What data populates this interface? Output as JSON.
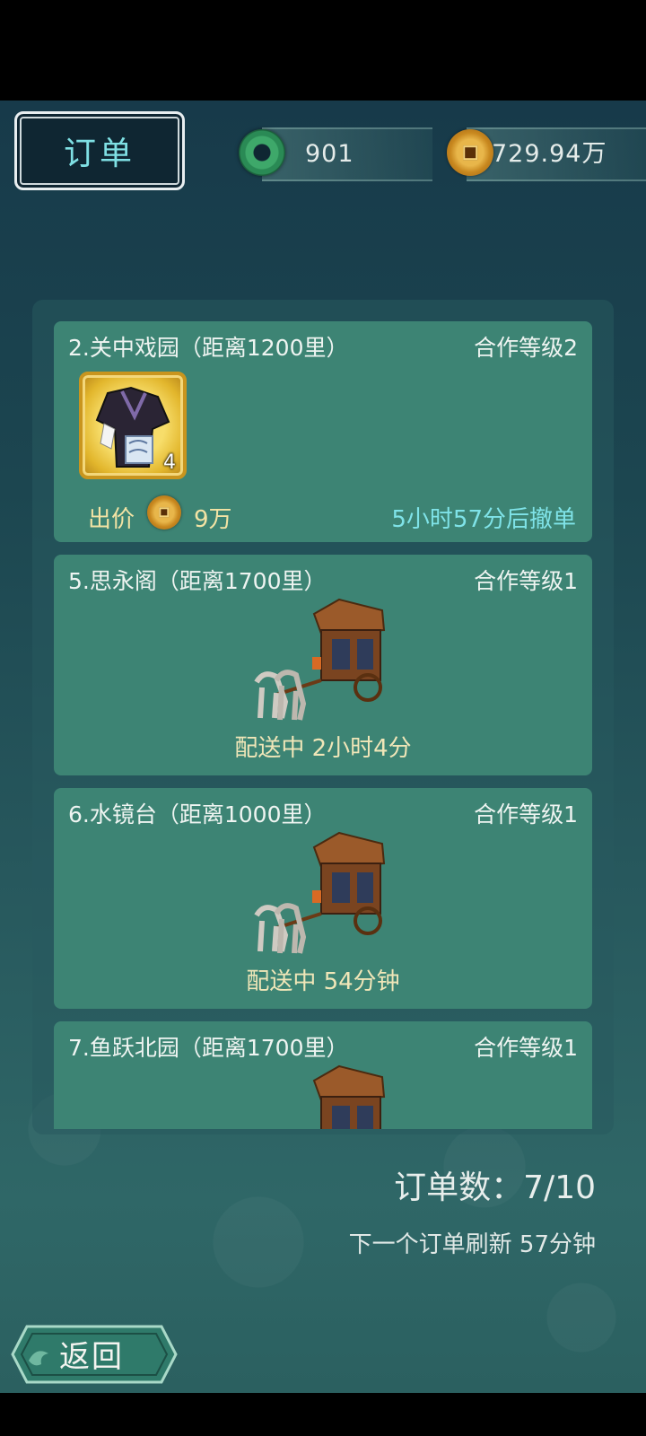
{
  "header": {
    "title": "订单",
    "jade_amount": "901",
    "coin_amount": "729.94万"
  },
  "orders": [
    {
      "name": "2.关中戏园（距离1200里）",
      "level": "合作等级2",
      "item_count": "4",
      "price_label": "出价",
      "price_value": "9万",
      "cancel_text": "5小时57分后撤单"
    },
    {
      "name": "5.思永阁（距离1700里）",
      "level": "合作等级1",
      "status": "配送中 2小时4分"
    },
    {
      "name": "6.水镜台（距离1000里）",
      "level": "合作等级1",
      "status": "配送中 54分钟"
    },
    {
      "name": "7.鱼跃北园（距离1700里）",
      "level": "合作等级1"
    }
  ],
  "footer": {
    "orders_count": "订单数：7/10",
    "refresh_text": "下一个订单刷新 57分钟",
    "back_label": "返回"
  },
  "colors": {
    "card_bg": "#3d8474",
    "accent_cyan": "#7fe3e8",
    "gold_text": "#f3e3a4"
  }
}
